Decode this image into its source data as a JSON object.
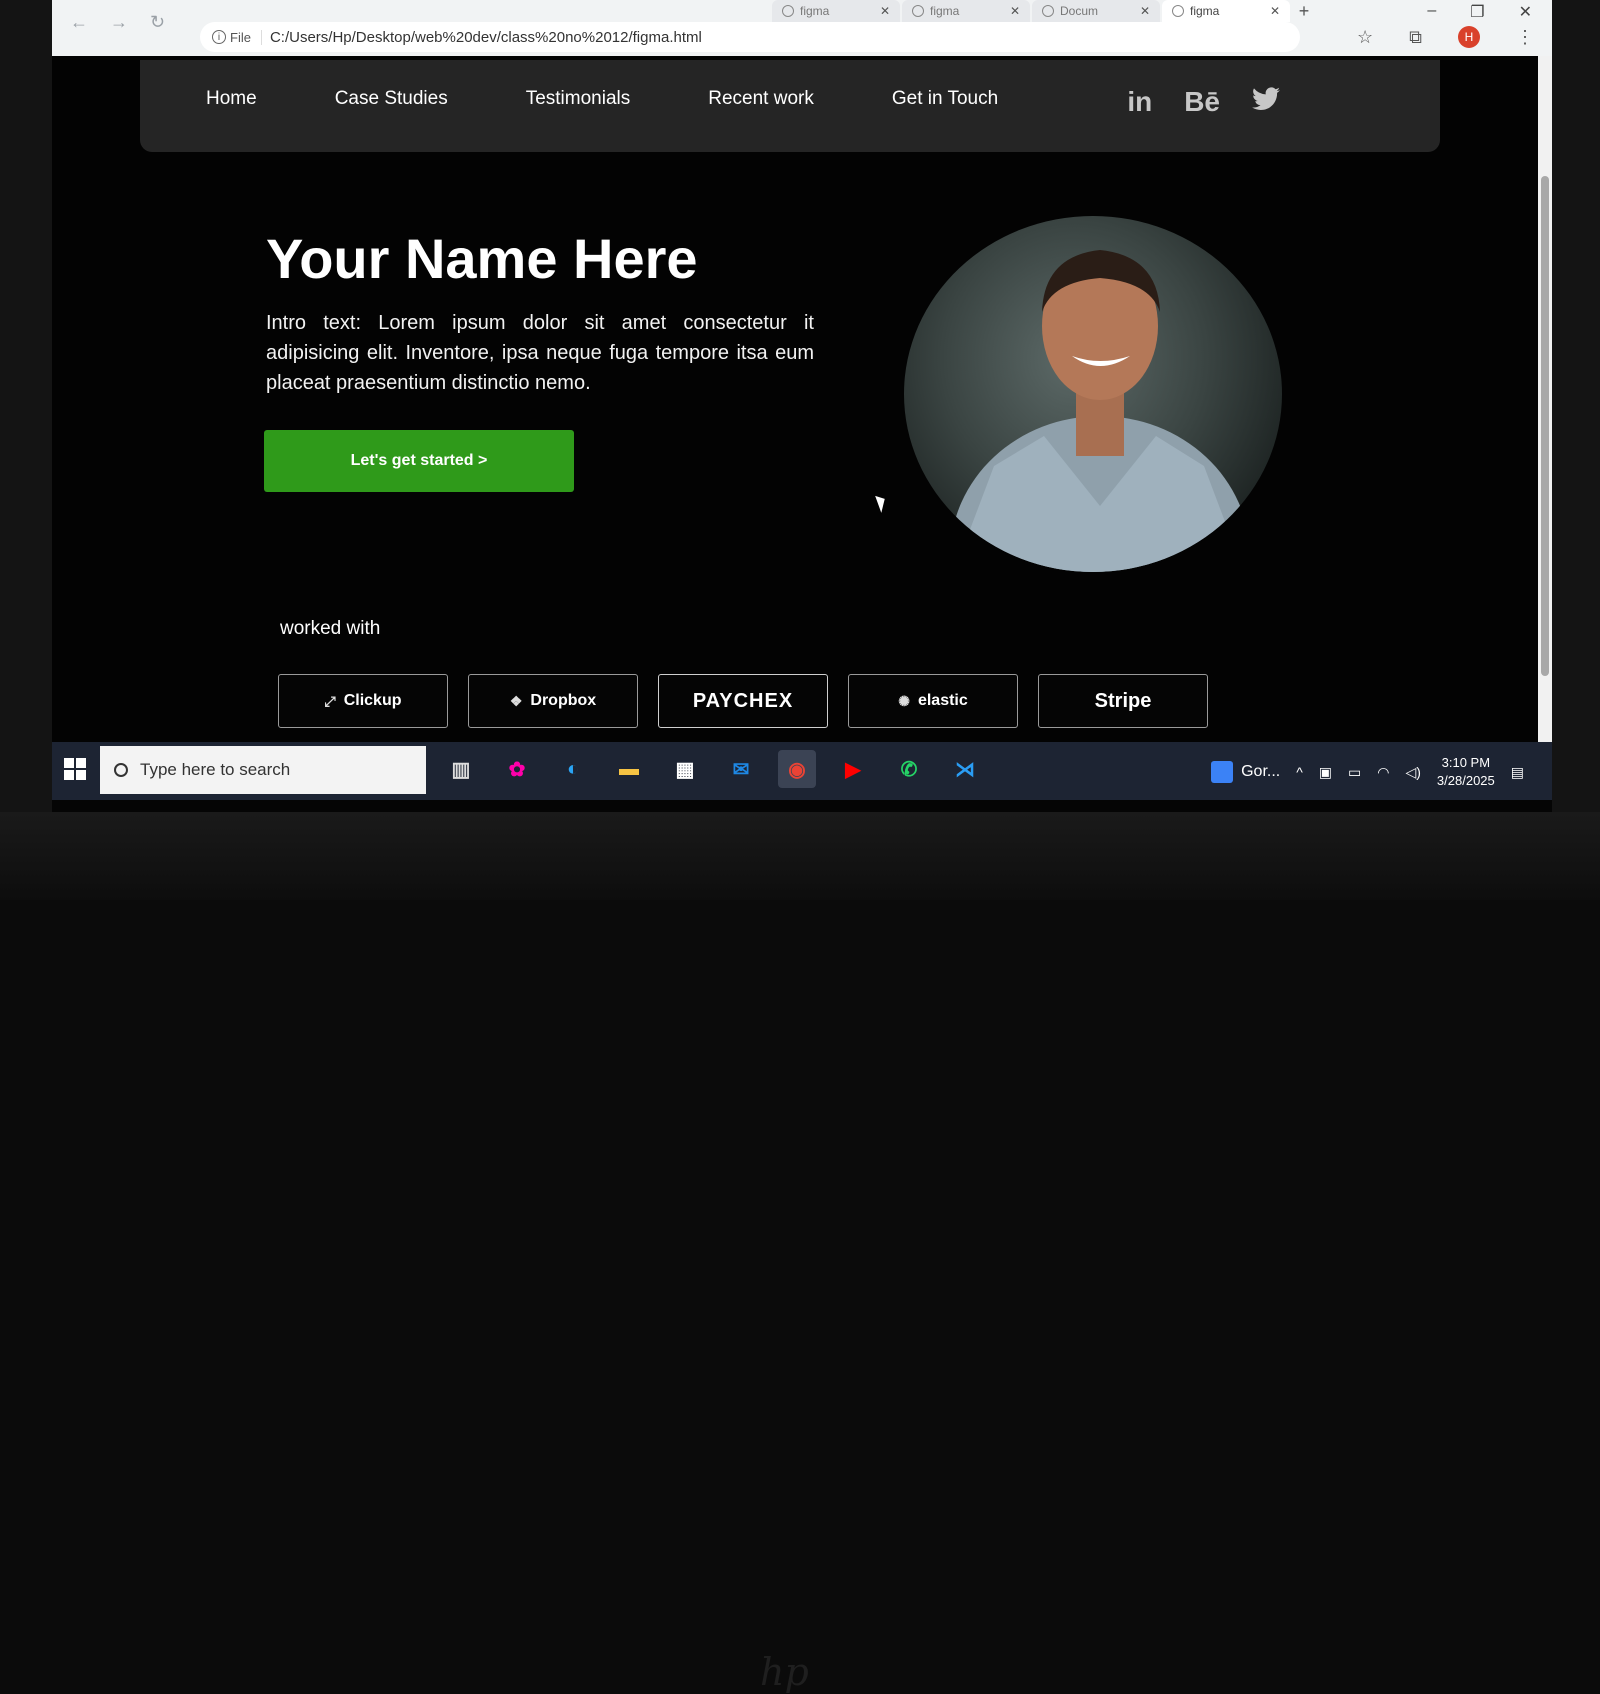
{
  "browser": {
    "tabs": [
      {
        "title": "figma",
        "active": false
      },
      {
        "title": "figma",
        "active": false
      },
      {
        "title": "Docum",
        "active": false
      },
      {
        "title": "figma",
        "active": true
      }
    ],
    "address_prefix": "File",
    "url": "C:/Users/Hp/Desktop/web%20dev/class%20no%2012/figma.html",
    "profile_initial": "H"
  },
  "nav": {
    "links": [
      "Home",
      "Case Studies",
      "Testimonials",
      "Recent work",
      "Get in Touch"
    ],
    "social": [
      {
        "name": "linkedin-icon",
        "glyph": "in"
      },
      {
        "name": "behance-icon",
        "glyph": "Bē"
      },
      {
        "name": "twitter-icon",
        "glyph": "🐦"
      }
    ]
  },
  "hero": {
    "title": "Your Name Here",
    "intro": "Intro text: Lorem ipsum dolor sit amet consectetur it adipisicing elit. Inventore, ipsa neque fuga tempore itsa eum placeat praesentium distinctio nemo.",
    "cta_label": "Let's get started >"
  },
  "worked_with": {
    "heading": "worked with",
    "logos": [
      "Clickup",
      "Dropbox",
      "PAYCHEX",
      "elastic",
      "Stripe"
    ]
  },
  "taskbar": {
    "search_placeholder": "Type here to search",
    "tray_app_label": "Gor...",
    "time": "3:10 PM",
    "date": "3/28/2025"
  },
  "colors": {
    "cta": "#2f9a1a",
    "nav_bg": "#252525",
    "page_bg": "#030303"
  }
}
